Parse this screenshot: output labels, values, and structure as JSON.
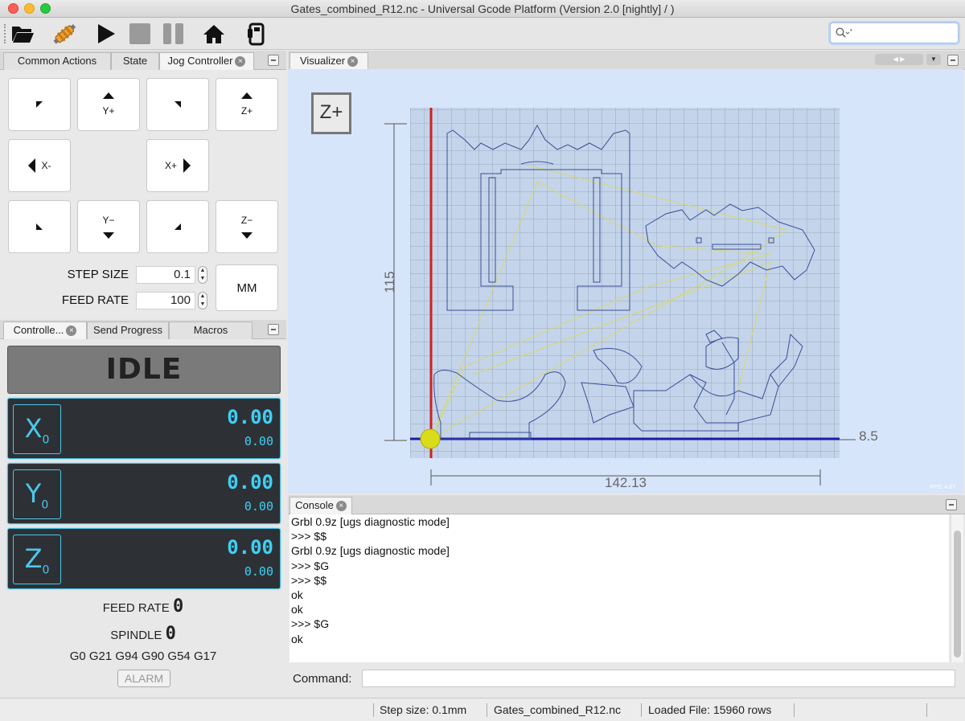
{
  "window": {
    "title": "Gates_combined_R12.nc - Universal Gcode Platform (Version 2.0 [nightly]  / )"
  },
  "toolbar": {
    "search_value": "'"
  },
  "left_top_tabs": [
    {
      "label": "Common Actions"
    },
    {
      "label": "State"
    },
    {
      "label": "Jog Controller"
    }
  ],
  "jog": {
    "y_plus": "Y+",
    "z_plus": "Z+",
    "x_minus": "X-",
    "x_plus": "X+",
    "y_minus": "Y−",
    "z_minus": "Z−",
    "step_size_label": "STEP SIZE",
    "step_size_value": "0.1",
    "feed_rate_label": "FEED RATE",
    "feed_rate_value": "100",
    "unit_button": "MM"
  },
  "left_bottom_tabs": [
    {
      "label": "Controlle..."
    },
    {
      "label": "Send Progress"
    },
    {
      "label": "Macros"
    }
  ],
  "controller": {
    "state": "IDLE",
    "axes": [
      {
        "name": "X",
        "sub": "0",
        "work": "0.00",
        "machine": "0.00"
      },
      {
        "name": "Y",
        "sub": "0",
        "work": "0.00",
        "machine": "0.00"
      },
      {
        "name": "Z",
        "sub": "0",
        "work": "0.00",
        "machine": "0.00"
      }
    ],
    "feed_rate_label": "FEED RATE",
    "feed_rate_value": "0",
    "spindle_label": "SPINDLE",
    "spindle_value": "0",
    "gcode_state": "G0 G21 G94 G90 G54 G17",
    "alarm_label": "ALARM"
  },
  "visualizer": {
    "tab_label": "Visualizer",
    "zplus_label": "Z+",
    "dim_height": "115",
    "dim_width": "142.13",
    "dim_right": "8.5",
    "fps": "FPS: 4.67"
  },
  "console": {
    "tab_label": "Console",
    "lines": [
      "Grbl 0.9z [ugs diagnostic mode]",
      ">>> $$",
      "Grbl 0.9z [ugs diagnostic mode]",
      ">>> $G",
      ">>> $$",
      "ok",
      "ok",
      ">>> $G",
      "ok"
    ],
    "command_label": "Command:",
    "command_value": ""
  },
  "statusbar": {
    "step_size": "Step size: 0.1mm",
    "file_name": "Gates_combined_R12.nc",
    "loaded_file": "Loaded File: 15960 rows"
  }
}
